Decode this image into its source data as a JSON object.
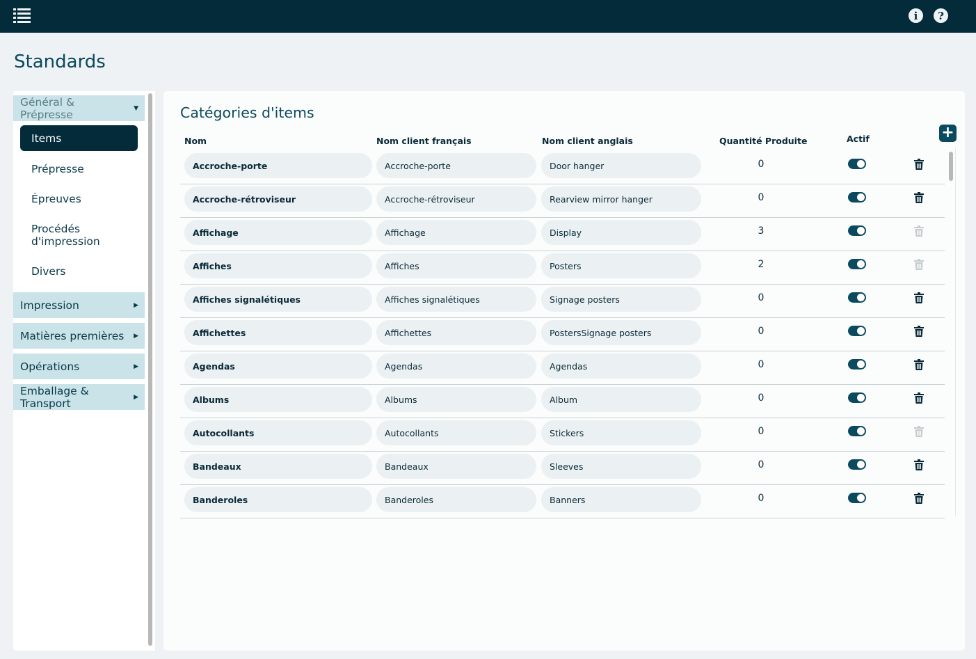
{
  "header": {
    "menu_icon": "hamburger-list-icon",
    "info_icon": "info-icon",
    "help_icon": "question-icon"
  },
  "page_title": "Standards",
  "sidebar": {
    "groups": [
      {
        "label": "Général & Prépresse",
        "expanded": true,
        "items": [
          "Items",
          "Prépresse",
          "Épreuves",
          "Procédés d'impression",
          "Divers"
        ],
        "active": "Items"
      },
      {
        "label": "Impression",
        "expanded": false
      },
      {
        "label": "Matières premières",
        "expanded": false
      },
      {
        "label": "Opérations",
        "expanded": false
      },
      {
        "label": "Emballage & Transport",
        "expanded": false
      }
    ]
  },
  "main": {
    "title": "Catégories d'items",
    "add_icon": "plus-icon",
    "columns": [
      "Nom",
      "Nom client français",
      "Nom client anglais",
      "Quantité Produite",
      "Actif"
    ],
    "rows": [
      {
        "nom": "Accroche-porte",
        "fr": "Accroche-porte",
        "en": "Door hanger",
        "qty": "0",
        "actif": true,
        "deletable": true
      },
      {
        "nom": "Accroche-rétroviseur",
        "fr": "Accroche-rétroviseur",
        "en": "Rearview mirror hanger",
        "qty": "0",
        "actif": true,
        "deletable": true
      },
      {
        "nom": "Affichage",
        "fr": "Affichage",
        "en": "Display",
        "qty": "3",
        "actif": true,
        "deletable": false
      },
      {
        "nom": "Affiches",
        "fr": "Affiches",
        "en": "Posters",
        "qty": "2",
        "actif": true,
        "deletable": false
      },
      {
        "nom": "Affiches signalétiques",
        "fr": "Affiches signalétiques",
        "en": "Signage posters",
        "qty": "0",
        "actif": true,
        "deletable": true
      },
      {
        "nom": "Affichettes",
        "fr": "Affichettes",
        "en": "PostersSignage posters",
        "qty": "0",
        "actif": true,
        "deletable": true
      },
      {
        "nom": "Agendas",
        "fr": "Agendas",
        "en": "Agendas",
        "qty": "0",
        "actif": true,
        "deletable": true
      },
      {
        "nom": "Albums",
        "fr": "Albums",
        "en": "Album",
        "qty": "0",
        "actif": true,
        "deletable": true
      },
      {
        "nom": "Autocollants",
        "fr": "Autocollants",
        "en": "Stickers",
        "qty": "0",
        "actif": true,
        "deletable": false
      },
      {
        "nom": "Bandeaux",
        "fr": "Bandeaux",
        "en": "Sleeves",
        "qty": "0",
        "actif": true,
        "deletable": true
      },
      {
        "nom": "Banderoles",
        "fr": "Banderoles",
        "en": "Banners",
        "qty": "0",
        "actif": true,
        "deletable": true
      }
    ]
  }
}
